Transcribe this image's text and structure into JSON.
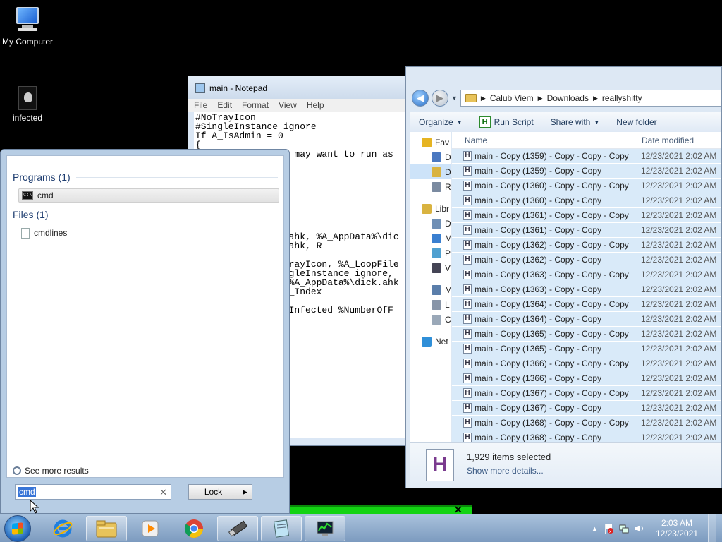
{
  "desktop": {
    "icons": [
      {
        "label": "My Computer",
        "icon": "computer-icon"
      },
      {
        "label": "infected",
        "icon": "skull-file-icon"
      }
    ]
  },
  "notepad": {
    "title": "main - Notepad",
    "menu": [
      "File",
      "Edit",
      "Format",
      "View",
      "Help"
    ],
    "lines": [
      "#NoTrayIcon",
      "#SingleInstance ignore",
      "If A_IsAdmin = 0",
      "{",
      "                u may want to run as",
      "",
      "",
      "",
      "",
      "",
      "",
      "",
      "",
      "                .ahk, %A_AppData%\\dic",
      "                .ahk, R",
      "",
      "                TrayIcon, %A_LoopFile",
      "                ngleInstance ignore,",
      "                 %A_AppData%\\dick.ahk",
      "                A_Index",
      "",
      "                 Infected %NumberOfF"
    ]
  },
  "explorer": {
    "breadcrumb": [
      "Calub Viem",
      "Downloads",
      "reallyshitty"
    ],
    "toolbar": {
      "organize": "Organize",
      "run_script": "Run Script",
      "share_with": "Share with",
      "new_folder": "New folder"
    },
    "nav": [
      {
        "label": "Fav",
        "icon": "star-icon",
        "gap": false,
        "selected": false
      },
      {
        "label": "D",
        "icon": "desktop-icon",
        "gap": false,
        "selected": false
      },
      {
        "label": "D",
        "icon": "downloads-icon",
        "gap": false,
        "selected": true
      },
      {
        "label": "R",
        "icon": "recent-places-icon",
        "gap": false,
        "selected": false
      },
      {
        "label": "Libr",
        "icon": "libraries-icon",
        "gap": true,
        "selected": false
      },
      {
        "label": "D",
        "icon": "documents-icon",
        "gap": false,
        "selected": false
      },
      {
        "label": "M",
        "icon": "music-icon",
        "gap": false,
        "selected": false
      },
      {
        "label": "P",
        "icon": "pictures-icon",
        "gap": false,
        "selected": false
      },
      {
        "label": "V",
        "icon": "videos-icon",
        "gap": false,
        "selected": false
      },
      {
        "label": "My",
        "icon": "computer-icon",
        "gap": true,
        "selected": false
      },
      {
        "label": "L",
        "icon": "local-disk-icon",
        "gap": false,
        "selected": false
      },
      {
        "label": "C",
        "icon": "dvd-drive-icon",
        "gap": false,
        "selected": false
      },
      {
        "label": "Net",
        "icon": "network-icon",
        "gap": true,
        "selected": false
      }
    ],
    "columns": {
      "name": "Name",
      "date": "Date modified"
    },
    "files": [
      {
        "name": "main - Copy (1359) - Copy - Copy - Copy",
        "date": "12/23/2021 2:02 AM"
      },
      {
        "name": "main - Copy (1359) - Copy - Copy",
        "date": "12/23/2021 2:02 AM"
      },
      {
        "name": "main - Copy (1360) - Copy - Copy - Copy",
        "date": "12/23/2021 2:02 AM"
      },
      {
        "name": "main - Copy (1360) - Copy - Copy",
        "date": "12/23/2021 2:02 AM"
      },
      {
        "name": "main - Copy (1361) - Copy - Copy - Copy",
        "date": "12/23/2021 2:02 AM"
      },
      {
        "name": "main - Copy (1361) - Copy - Copy",
        "date": "12/23/2021 2:02 AM"
      },
      {
        "name": "main - Copy (1362) - Copy - Copy - Copy",
        "date": "12/23/2021 2:02 AM"
      },
      {
        "name": "main - Copy (1362) - Copy - Copy",
        "date": "12/23/2021 2:02 AM"
      },
      {
        "name": "main - Copy (1363) - Copy - Copy - Copy",
        "date": "12/23/2021 2:02 AM"
      },
      {
        "name": "main - Copy (1363) - Copy - Copy",
        "date": "12/23/2021 2:02 AM"
      },
      {
        "name": "main - Copy (1364) - Copy - Copy - Copy",
        "date": "12/23/2021 2:02 AM"
      },
      {
        "name": "main - Copy (1364) - Copy - Copy",
        "date": "12/23/2021 2:02 AM"
      },
      {
        "name": "main - Copy (1365) - Copy - Copy - Copy",
        "date": "12/23/2021 2:02 AM"
      },
      {
        "name": "main - Copy (1365) - Copy - Copy",
        "date": "12/23/2021 2:02 AM"
      },
      {
        "name": "main - Copy (1366) - Copy - Copy - Copy",
        "date": "12/23/2021 2:02 AM"
      },
      {
        "name": "main - Copy (1366) - Copy - Copy",
        "date": "12/23/2021 2:02 AM"
      },
      {
        "name": "main - Copy (1367) - Copy - Copy - Copy",
        "date": "12/23/2021 2:02 AM"
      },
      {
        "name": "main - Copy (1367) - Copy - Copy",
        "date": "12/23/2021 2:02 AM"
      },
      {
        "name": "main - Copy (1368) - Copy - Copy - Copy",
        "date": "12/23/2021 2:02 AM"
      },
      {
        "name": "main - Copy (1368) - Copy - Copy",
        "date": "12/23/2021 2:02 AM"
      }
    ],
    "details": {
      "count": "1,929 items selected",
      "more": "Show more details..."
    }
  },
  "startmenu": {
    "programs_heading": "Programs (1)",
    "programs": [
      {
        "label": "cmd",
        "icon": "cmd-icon"
      }
    ],
    "files_heading": "Files (1)",
    "files": [
      {
        "label": "cmdlines",
        "icon": "text-file-icon"
      }
    ],
    "see_more": "See more results",
    "search_value": "cmd",
    "lock_label": "Lock"
  },
  "taskbar": {
    "pinned": [
      "internet-explorer-icon",
      "folder-icon",
      "media-player-icon",
      "chrome-icon",
      "usb-tool-icon",
      "notepad-icon",
      "task-manager-icon"
    ],
    "clock_time": "2:03 AM",
    "clock_date": "12/23/2021"
  },
  "colors": {
    "accent": "#3875d7",
    "selection": "#d9eaf9",
    "taskbar": "#7c9bbf",
    "green_window": "#13d313"
  }
}
